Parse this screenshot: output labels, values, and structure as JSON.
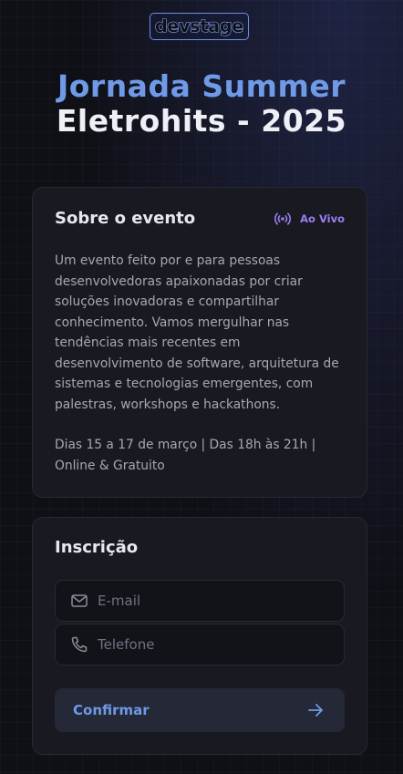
{
  "header": {
    "logo_text": "devstage",
    "title_line1": "Jornada Summer",
    "title_line2": "Eletrohits - 2025"
  },
  "about": {
    "title": "Sobre o evento",
    "live_label": "Ao Vivo",
    "live_icon": "broadcast-icon",
    "description": "Um evento feito por e para pessoas desenvolvedoras apaixonadas por criar soluções inovadoras e compartilhar conhecimento. Vamos mergulhar nas tendências mais recentes em desenvolvimento de software, arquitetura de sistemas e tecnologias emergentes, com palestras, workshops e hackathons.",
    "info": "Dias 15 a 17 de março | Das 18h às 21h | Online & Gratuito"
  },
  "signup": {
    "title": "Inscrição",
    "email_placeholder": "E-mail",
    "email_icon": "mail-icon",
    "phone_placeholder": "Telefone",
    "phone_icon": "phone-icon",
    "confirm_label": "Confirmar",
    "confirm_icon": "arrow-right-icon"
  },
  "colors": {
    "accent_blue": "#6f9ae8",
    "live_purple": "#9a7cf0",
    "background": "#0f1016",
    "card": "#191a21"
  }
}
